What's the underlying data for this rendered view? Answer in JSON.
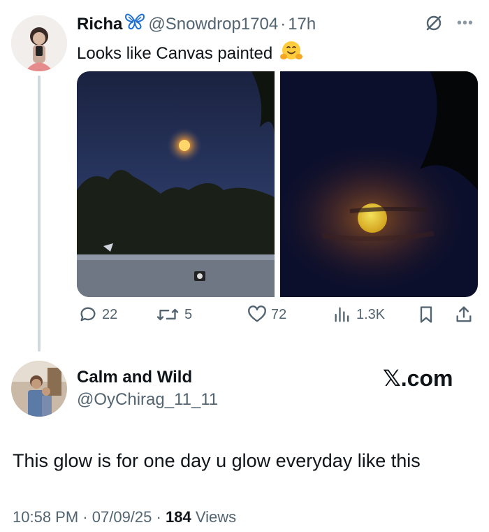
{
  "original_tweet": {
    "author_name": "Richa",
    "handle": "@Snowdrop1704",
    "separator": "·",
    "time_ago": "17h",
    "text": "Looks like Canvas painted",
    "emoji": "hugging-face-emoji",
    "icons": [
      "butterfly-icon",
      "grok-icon",
      "more-icon"
    ],
    "media": [
      "moon-over-trees-photo",
      "orange-moon-closeup-photo"
    ],
    "actions": {
      "replies": "22",
      "retweets": "5",
      "likes": "72",
      "views": "1.3K"
    }
  },
  "reply": {
    "author_name": "Calm and Wild",
    "handle": "@OyChirag_11_11",
    "text": "This glow is for one day u glow everyday like this",
    "time": "10:58 PM",
    "date": "07/09/25",
    "views_count": "184",
    "views_label": "Views",
    "separator": "·"
  },
  "watermark": {
    "x_glyph": "𝕏",
    "text": ".com"
  },
  "colors": {
    "text": "#0f1419",
    "muted": "#536471",
    "thread_line": "#cfd9de",
    "verified_blue": "#1d9bf0"
  }
}
